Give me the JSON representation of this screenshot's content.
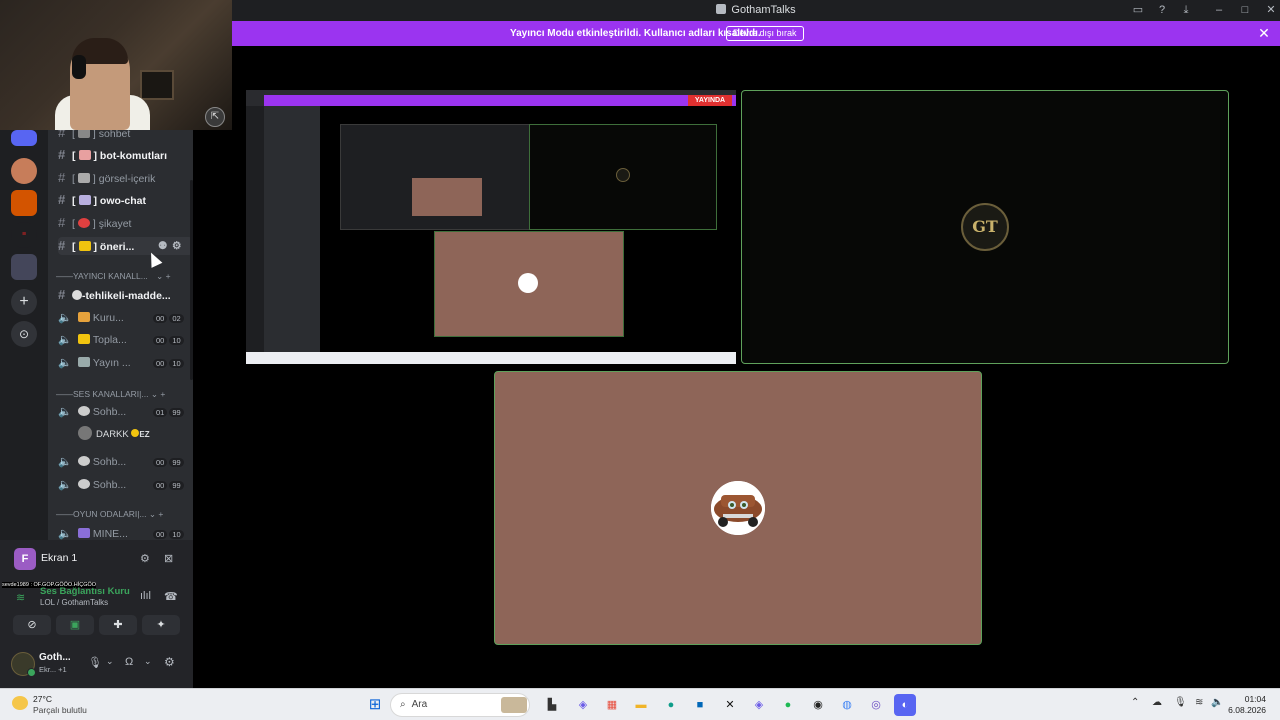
{
  "window": {
    "title": "GothamTalks"
  },
  "banner": {
    "message": "Yayıncı Modu etkinleştirildi. Kullanıcı adları kısaltıldı.",
    "disable_button": "Devre dışı bırak"
  },
  "channels": {
    "items": [
      {
        "name": "sohbet",
        "prefix": "#",
        "style": "dim"
      },
      {
        "name": "bot-komutları",
        "prefix": "#",
        "style": "bold"
      },
      {
        "name": "görsel-içerik",
        "prefix": "#",
        "style": "dim"
      },
      {
        "name": "owo-chat",
        "prefix": "#",
        "style": "bold"
      },
      {
        "name": "şikayet",
        "prefix": "#",
        "style": "dim"
      },
      {
        "name": "öneri...",
        "prefix": "#",
        "style": "bold"
      }
    ],
    "category_yayinci": "YAYINCI KANALL...",
    "tehlikeli": "-tehlikeli-madde...",
    "voice_yayinci": [
      {
        "name": "Kuru...",
        "counts": [
          "00",
          "02"
        ]
      },
      {
        "name": "Topla...",
        "counts": [
          "00",
          "10"
        ]
      },
      {
        "name": "Yayın ...",
        "counts": [
          "00",
          "10"
        ]
      }
    ],
    "category_ses": "SES KANALLARI|...",
    "voice_ses": [
      {
        "name": "Sohb...",
        "counts": [
          "01",
          "99"
        ]
      },
      {
        "name": "Sohb...",
        "counts": [
          "00",
          "99"
        ]
      },
      {
        "name": "Sohb...",
        "counts": [
          "00",
          "99"
        ]
      }
    ],
    "voice_member": {
      "name": "DARKK",
      "badge": "EZ"
    },
    "category_oyun": "OYUN ODALARI|...",
    "voice_oyun": [
      {
        "name": "MINE...",
        "counts": [
          "00",
          "10"
        ]
      }
    ]
  },
  "ekran_panel": {
    "label": "Ekran 1",
    "avatar_letter": "F",
    "overlay_text": "sevde1989 : OF.GOP.GÖÖO.HİÇGÖO",
    "voice_status": "Ses Bağlantısı Kuru",
    "voice_channel": "LOL / GothamTalks"
  },
  "user_panel": {
    "name": "Goth...",
    "status": "Ekr... +1"
  },
  "stage": {
    "mini_banner": "YAYINDA",
    "gt_logo": "GT"
  },
  "taskbar": {
    "weather_temp": "27°C",
    "weather_desc": "Parçalı bulutlu",
    "search_label": "Ara",
    "time": "01:04",
    "date": "6.08.2026"
  },
  "colors": {
    "banner_bg": "#9b34f0",
    "tile_border": "#5fa15b",
    "mater_bg": "#8e6558",
    "sidebar_bg": "#2b2d31",
    "rail_bg": "#1e1f22"
  }
}
